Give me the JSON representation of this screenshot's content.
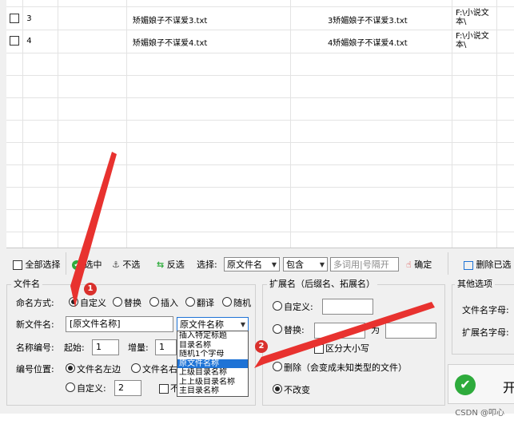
{
  "file_rows": [
    {
      "index": "3",
      "name": "矫媚娘子不谋爱3.txt",
      "new_name": "3矫媚娘子不谋爱3.txt",
      "path": "F:\\小说文本\\"
    },
    {
      "index": "4",
      "name": "矫媚娘子不谋爱4.txt",
      "new_name": "4矫媚娘子不谋爱4.txt",
      "path": "F:\\小说文本\\"
    }
  ],
  "toolbar": {
    "select_all": "全部选择",
    "select": "选中",
    "deselect": "不选",
    "invert": "反选",
    "choose_label": "选择:",
    "choose_value": "原文件名",
    "match_value": "包含",
    "keywords_placeholder": "多词用|号隔开",
    "confirm": "确定",
    "delete_selected": "删除已选"
  },
  "filename_group": {
    "title": "文件名",
    "mode_label": "命名方式:",
    "modes": [
      "自定义",
      "替换",
      "插入",
      "翻译",
      "随机"
    ],
    "new_name_label": "新文件名:",
    "new_name_value": "[原文件名称]",
    "insert_select_value": "原文件名称",
    "number_label": "名称编号:",
    "start_label": "起始:",
    "start_value": "1",
    "increment_label": "增量:",
    "increment_value": "1",
    "position_label": "编号位置:",
    "pos_left": "文件名左边",
    "pos_right": "文件名右",
    "pos_custom": "自定义:",
    "pos_custom_value": "2",
    "not_label": "不"
  },
  "dropdown_options": [
    "插入特定标题",
    "目录名称",
    "随机1个字母",
    "原文件名称",
    "上级目录名称",
    "上上级目录名称",
    "主目录名称"
  ],
  "dropdown_selected": "原文件名称",
  "ext_group": {
    "title": "扩展名（后缀名、拓展名）",
    "custom": "自定义:",
    "replace": "替换:",
    "to": "为",
    "case": "区分大小写",
    "delete": "删除（会变成未知类型的文件）",
    "keep": "不改变"
  },
  "other_group": {
    "title": "其他选项",
    "filename_font": "文件名字母:",
    "ext_font": "扩展名字母:"
  },
  "start_button": "开",
  "badges": [
    "1",
    "2"
  ],
  "watermark": "CSDN @叩心",
  "colors": {
    "accent": "#1e73d6",
    "arrow": "#e8322f",
    "start_green": "#2eab3c"
  }
}
